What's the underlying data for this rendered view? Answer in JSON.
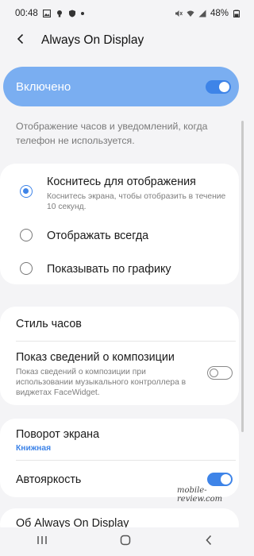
{
  "status_bar": {
    "time": "00:48",
    "battery": "48%",
    "icons": [
      "image-icon",
      "bulb-icon",
      "shield-icon",
      "dot-icon",
      "mute-icon",
      "wifi-icon",
      "signal-icon",
      "battery-icon"
    ]
  },
  "header": {
    "title": "Always On Display",
    "back_icon": "back-arrow-icon"
  },
  "master_toggle": {
    "label": "Включено",
    "enabled": true
  },
  "description": "Отображение часов и уведомлений, когда телефон не используется.",
  "display_modes": [
    {
      "title": "Коснитесь для отображения",
      "subtitle": "Коснитесь экрана, чтобы отобразить в течение 10 секунд.",
      "selected": true
    },
    {
      "title": "Отображать всегда",
      "selected": false
    },
    {
      "title": "Показывать по графику",
      "selected": false
    }
  ],
  "settings": {
    "clock_style": {
      "title": "Стиль часов"
    },
    "music_info": {
      "title": "Показ сведений о композиции",
      "subtitle": "Показ сведений о композиции при использовании музыкального контроллера в виджетах FaceWidget.",
      "enabled": false
    }
  },
  "rotation": {
    "title": "Поворот экрана",
    "value": "Книжная"
  },
  "auto_brightness": {
    "title": "Автояркость",
    "enabled": true
  },
  "about": {
    "title": "Об Always On Display"
  },
  "watermark": "mobile-review.com",
  "nav_bar": {
    "icons": [
      "recent-apps-icon",
      "home-icon",
      "back-icon"
    ]
  },
  "colors": {
    "accent": "#3e84e8",
    "master_toggle_bg": "#7aaef1",
    "background": "#f4f4f6"
  }
}
